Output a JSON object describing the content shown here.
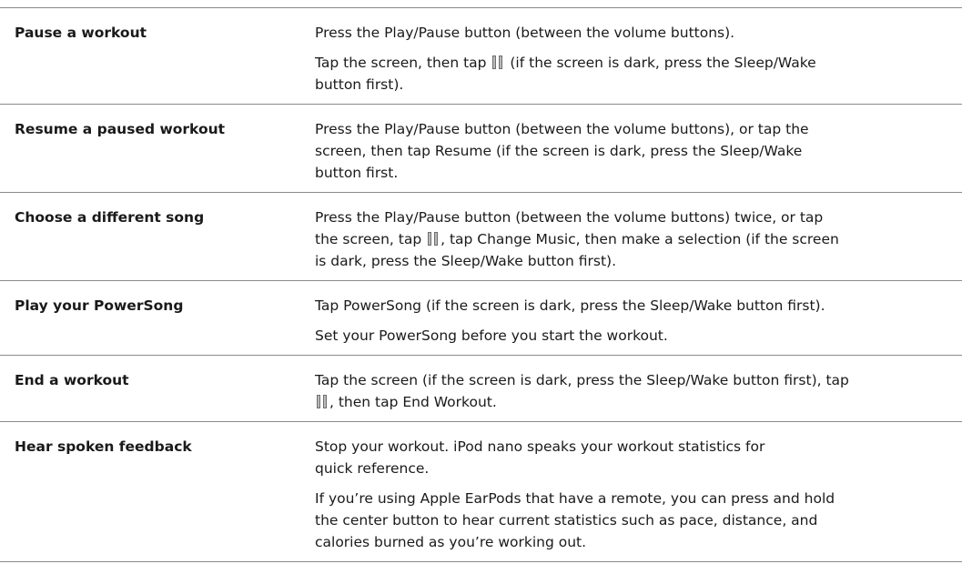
{
  "rows": [
    {
      "label": "Pause a workout",
      "lines": [
        [
          "Press the Play/Pause button (between the volume buttons)."
        ],
        [
          "Tap the screen, then tap ",
          {
            "icon": "pause-icon"
          },
          " (if the screen is dark, press the Sleep/Wake\nbutton first)."
        ]
      ]
    },
    {
      "label": "Resume a paused workout",
      "lines": [
        [
          "Press the Play/Pause button (between the volume buttons), or tap the\nscreen, then tap Resume (if the screen is dark, press the Sleep/Wake\nbutton first."
        ]
      ]
    },
    {
      "label": "Choose a different song",
      "lines": [
        [
          "Press the Play/Pause button (between the volume buttons) twice, or tap\nthe screen, tap ",
          {
            "icon": "pause-icon"
          },
          ", tap Change Music, then make a selection (if the screen\nis dark, press the Sleep/Wake button first)."
        ]
      ]
    },
    {
      "label": "Play your PowerSong",
      "lines": [
        [
          "Tap PowerSong (if the screen is dark, press the Sleep/Wake button first)."
        ],
        [
          "Set your PowerSong before you start the workout."
        ]
      ]
    },
    {
      "label": "End a workout",
      "lines": [
        [
          "Tap the screen (if the screen is dark, press the Sleep/Wake button first), tap\n",
          {
            "icon": "pause-icon"
          },
          ", then tap End Workout."
        ]
      ]
    },
    {
      "label": "Hear spoken feedback",
      "lines": [
        [
          "Stop your workout. iPod nano speaks your workout statistics for\nquick reference."
        ],
        [
          "If you’re using Apple EarPods that have a remote, you can press and hold\nthe center button to hear current statistics such as pace, distance, and\ncalories burned as you’re working out."
        ]
      ]
    }
  ]
}
